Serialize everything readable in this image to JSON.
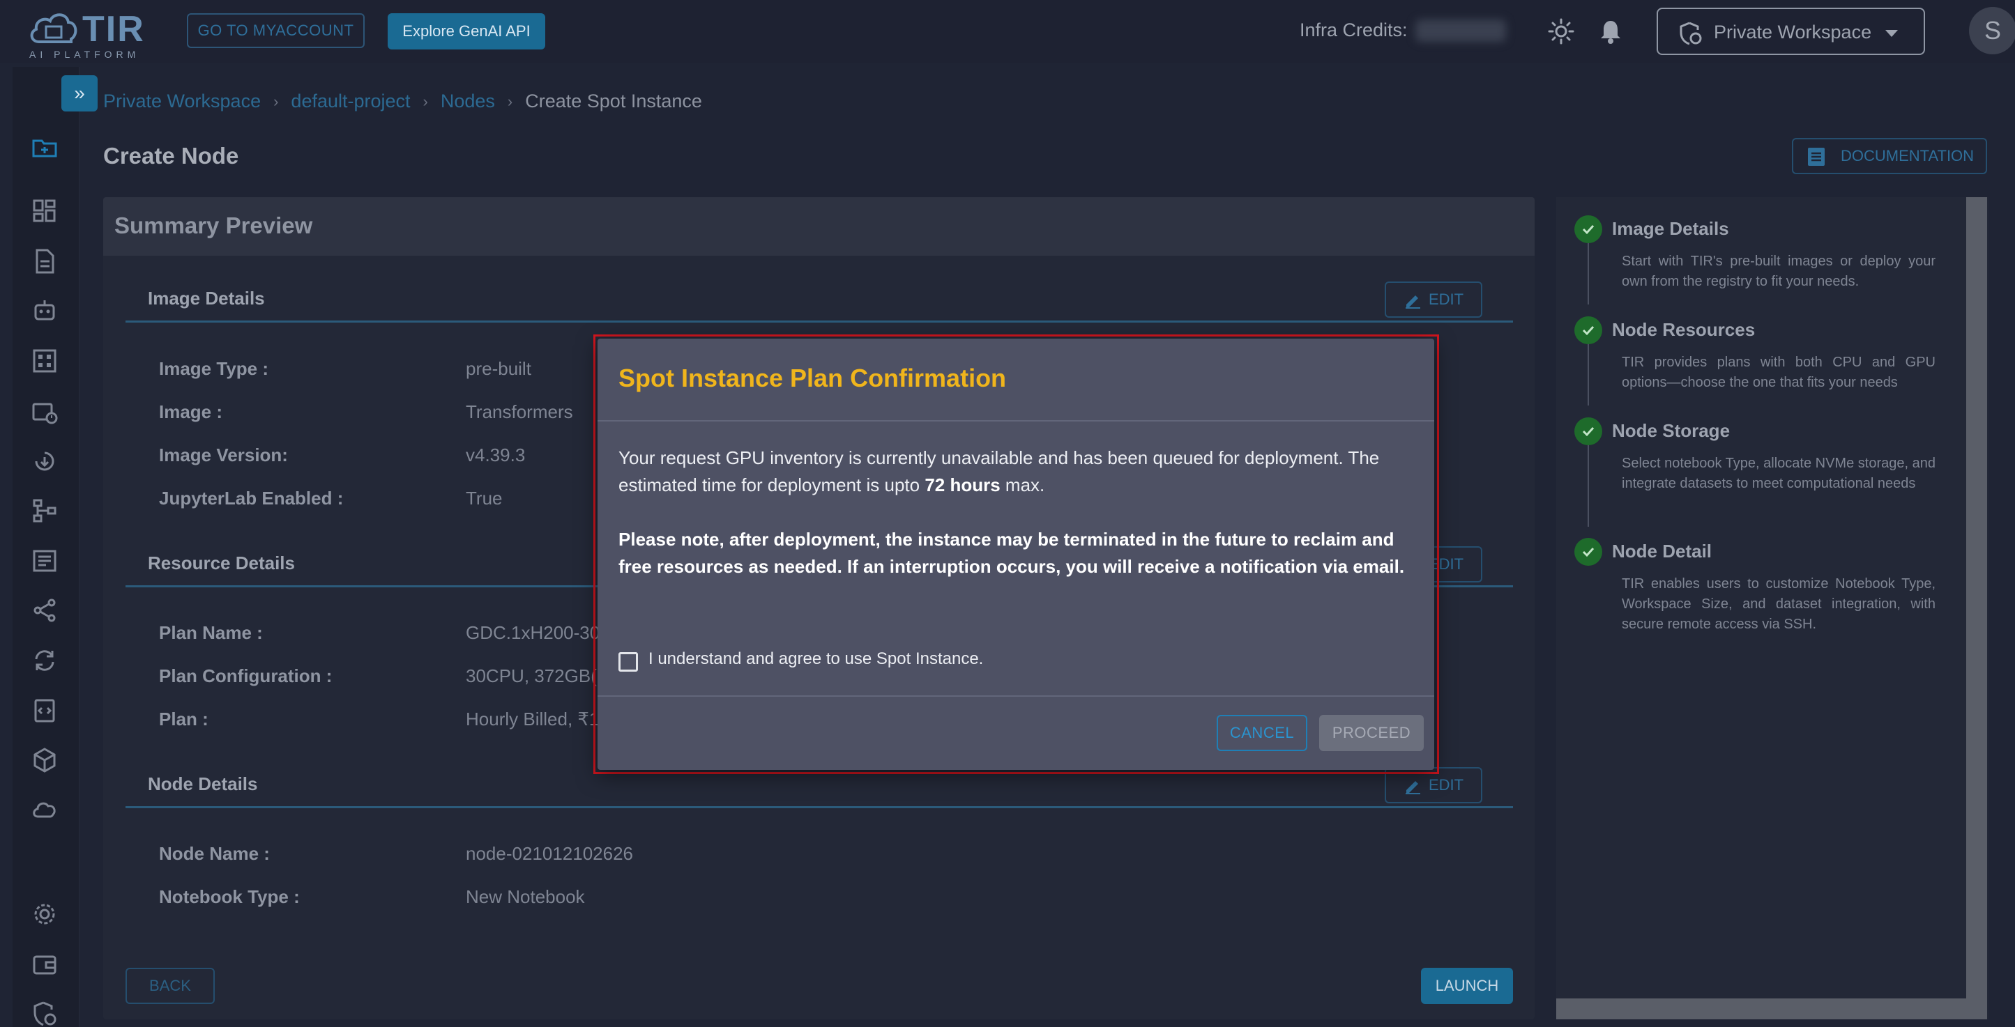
{
  "header": {
    "logo_text": "TIR",
    "logo_subtitle": "AI PLATFORM",
    "myaccount_button": "GO TO MYACCOUNT",
    "genai_button": "Explore GenAI API",
    "infra_credits_label": "Infra Credits:",
    "workspace_selector": "Private Workspace",
    "avatar_initial": "S"
  },
  "breadcrumb": {
    "items": [
      "Private Workspace",
      "default-project",
      "Nodes"
    ],
    "current": "Create Spot Instance",
    "separator": "›"
  },
  "page": {
    "title": "Create Node",
    "documentation_button": "DOCUMENTATION"
  },
  "summary": {
    "title": "Summary Preview",
    "edit_label": "EDIT",
    "sections": {
      "image": {
        "title": "Image Details",
        "rows": [
          {
            "label": "Image Type :",
            "value": "pre-built"
          },
          {
            "label": "Image :",
            "value": "Transformers"
          },
          {
            "label": "Image Version:",
            "value": "v4.39.3"
          },
          {
            "label": "JupyterLab Enabled :",
            "value": "True"
          }
        ]
      },
      "resource": {
        "title": "Resource Details",
        "rows": [
          {
            "label": "Plan Name :",
            "value": "GDC.1xH200-30"
          },
          {
            "label": "Plan Configuration :",
            "value": "30CPU, 372GB("
          },
          {
            "label": "Plan :",
            "value": "Hourly Billed, ₹1"
          }
        ]
      },
      "node": {
        "title": "Node Details",
        "rows": [
          {
            "label": "Node Name :",
            "value": "node-021012102626"
          },
          {
            "label": "Notebook Type :",
            "value": "New Notebook"
          }
        ]
      }
    },
    "back_button": "BACK",
    "launch_button": "LAUNCH"
  },
  "steps": [
    {
      "title": "Image Details",
      "desc": "Start with TIR's pre-built images or deploy your own from the registry to fit your needs."
    },
    {
      "title": "Node Resources",
      "desc": "TIR provides plans with both CPU and GPU options—choose the one that fits your needs"
    },
    {
      "title": "Node Storage",
      "desc": "Select notebook Type, allocate NVMe storage, and integrate datasets to meet computational needs"
    },
    {
      "title": "Node Detail",
      "desc": "TIR enables users to customize Notebook Type, Workspace Size, and dataset integration, with secure remote access via SSH."
    }
  ],
  "modal": {
    "title": "Spot Instance Plan Confirmation",
    "body_pre": "Your request GPU inventory is currently unavailable and has been queued for deployment. The estimated time for deployment is upto ",
    "body_bold": "72 hours",
    "body_post": " max.",
    "note": "Please note, after deployment, the instance may be terminated in the future to reclaim and free resources as needed. If an interruption occurs, you will receive a notification via email.",
    "agree_label": "I understand and agree to use Spot Instance.",
    "agree_checked": false,
    "cancel_button": "CANCEL",
    "proceed_button": "PROCEED"
  },
  "colors": {
    "accent": "#1a6a93",
    "modal_title": "#f0b51c",
    "highlight_border": "#d4161f",
    "step_check": "#1e6b2b"
  }
}
